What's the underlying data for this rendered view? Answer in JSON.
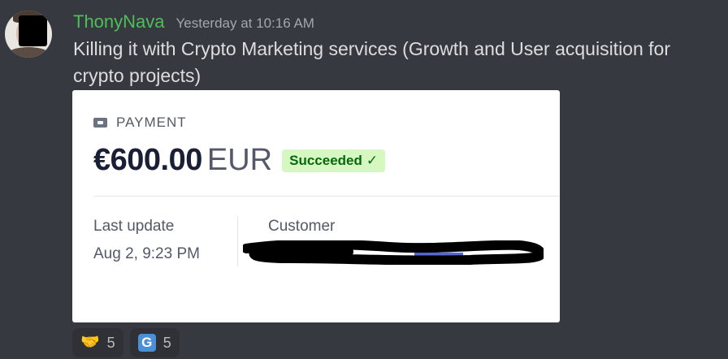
{
  "message": {
    "username": "ThonyNava",
    "timestamp": "Yesterday at 10:16 AM",
    "content": "Killing it with Crypto Marketing services (Growth and User acquisition for crypto projects)"
  },
  "payment": {
    "label": "PAYMENT",
    "amount": "€600.00",
    "currency": "EUR",
    "status": "Succeeded",
    "status_icon": "✓",
    "last_update_label": "Last update",
    "last_update_value": "Aug 2, 9:23 PM",
    "customer_label": "Customer"
  },
  "reactions": [
    {
      "emoji_name": "handshake-emoji",
      "emoji": "🤝",
      "count": "5"
    },
    {
      "emoji_name": "g-letter-emoji",
      "emoji": "G",
      "count": "5"
    }
  ],
  "colors": {
    "background": "#36393f",
    "username": "#4dbe59",
    "status_badge_bg": "#d7f7c2",
    "status_badge_text": "#05690d",
    "link": "#5469d4"
  }
}
